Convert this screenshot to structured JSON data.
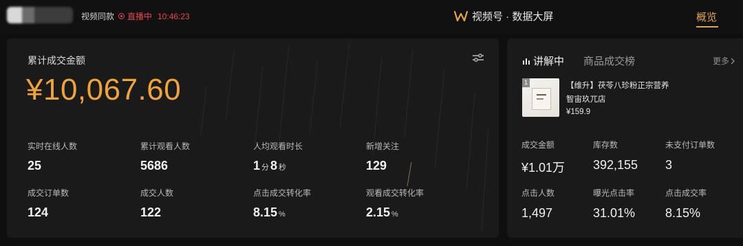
{
  "header": {
    "account_name": "视频同款",
    "live_status": "直播中",
    "live_time": "10:46:23",
    "brand_title": "视频号 · 数据大屏",
    "active_tab": "概览",
    "accent_color": "#e2a44e",
    "live_color": "#e5484d"
  },
  "overview": {
    "title": "累计成交金额",
    "total_amount": "¥10,067.60",
    "amount_color": "#f0a33b",
    "metrics": [
      {
        "label": "实时在线人数",
        "value": "25"
      },
      {
        "label": "累计观看人数",
        "value": "5686"
      },
      {
        "label": "人均观看时长",
        "value_minutes": "1",
        "unit_minutes": "分",
        "value_seconds": "8",
        "unit_seconds": "秒"
      },
      {
        "label": "新增关注",
        "value": "129"
      },
      {
        "label": "成交订单数",
        "value": "124"
      },
      {
        "label": "成交人数",
        "value": "122"
      },
      {
        "label": "点击成交转化率",
        "value": "8.15",
        "unit": "%"
      },
      {
        "label": "观看成交转化率",
        "value": "2.15",
        "unit": "%"
      }
    ]
  },
  "product_panel": {
    "tab_explaining": "讲解中",
    "tab_ranking": "商品成交榜",
    "more_label": "更多",
    "product": {
      "index": "1",
      "name": "【维升】茯苓八珍粉正宗营养",
      "shop": "智宙玖兀店",
      "price": "¥159.9"
    },
    "stats": [
      {
        "label": "成交金额",
        "value": "¥1.01万"
      },
      {
        "label": "库存数",
        "value": "392,155"
      },
      {
        "label": "未支付订单数",
        "value": "3"
      },
      {
        "label": "点击人数",
        "value": "1,497"
      },
      {
        "label": "曝光点击率",
        "value": "31.01%"
      },
      {
        "label": "点击成交率",
        "value": "8.15%"
      }
    ]
  }
}
